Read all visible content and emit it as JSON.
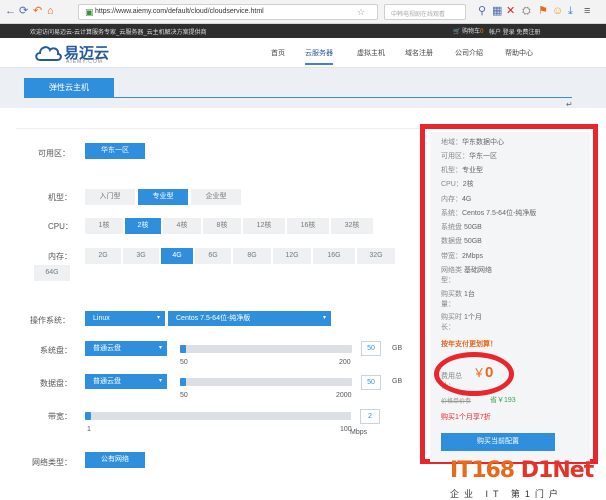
{
  "browser": {
    "url": "https://www.aiemy.com/default/cloud/cloudservice.html",
    "search_placeholder": "中韩电视剧在线观看",
    "icons": [
      "back-icon",
      "refresh-icon",
      "undo-icon",
      "home-icon",
      "lock-icon",
      "star-icon",
      "search-icon",
      "extension-icon",
      "user-icon",
      "download-icon"
    ]
  },
  "site_top": {
    "welcome": "欢迎访问易迈云-云计算服务专家_云服务器_云主机解决方案提供商",
    "cart": "购物车",
    "cart_count": "0",
    "links": "帐户  登录  免费注册"
  },
  "header": {
    "logo_cn": "易迈云",
    "logo_en": "AIEMY.COM",
    "nav": [
      {
        "label": "首页"
      },
      {
        "label": "云服务器",
        "active": true
      },
      {
        "label": "虚拟主机"
      },
      {
        "label": "域名注册"
      },
      {
        "label": "公司介绍"
      },
      {
        "label": "帮助中心"
      }
    ]
  },
  "tab": {
    "label": "弹性云主机"
  },
  "return_mark": "↵",
  "form": {
    "region": {
      "label": "可用区：",
      "value": "华东一区"
    },
    "model": {
      "label": "机型：",
      "options": [
        "入门型",
        "专业型",
        "企业型"
      ],
      "selected": 1
    },
    "cpu": {
      "label": "CPU：",
      "options": [
        "1核",
        "2核",
        "4核",
        "8核",
        "12核",
        "16核",
        "32核"
      ],
      "selected": 1
    },
    "memory": {
      "label": "内存：",
      "options": [
        "2G",
        "3G",
        "4G",
        "6G",
        "8G",
        "12G",
        "16G",
        "32G",
        "64G"
      ],
      "selected": 2
    },
    "os": {
      "label": "操作系统：",
      "family": "Linux",
      "image": "Centos 7.5-64位-纯净版"
    },
    "system_disk": {
      "label": "系统盘：",
      "type": "普通云盘",
      "min": "50",
      "max": "200",
      "value": "50",
      "unit": "GB",
      "fill": 0.02
    },
    "data_disk": {
      "label": "数据盘：",
      "type": "普通云盘",
      "min": "50",
      "max": "2000",
      "value": "50",
      "unit": "GB",
      "fill": 0.02
    },
    "bandwidth": {
      "label": "带宽：",
      "min": "1",
      "max": "100",
      "value": "2",
      "unit": "Mbps",
      "fill": 0.01
    },
    "network": {
      "label": "网络类型：",
      "value": "公有网络"
    }
  },
  "summary": {
    "rows": [
      {
        "k": "地域：",
        "v": "华东数据中心"
      },
      {
        "k": "可用区：",
        "v": "华东一区"
      },
      {
        "k": "机型：",
        "v": "专业型"
      },
      {
        "k": "CPU：",
        "v": "2核"
      },
      {
        "k": "内存：",
        "v": "4G"
      },
      {
        "k": "系统：",
        "v": "Centos 7.5-64位-纯净版"
      },
      {
        "k": "系统盘",
        "v": "50GB"
      },
      {
        "k": "数据盘",
        "v": "50GB"
      },
      {
        "k": "带宽：",
        "v": "2Mbps"
      },
      {
        "k": "网络类",
        "v": "基础网络",
        "k2": "型："
      },
      {
        "k": "购买数",
        "v": "1台",
        "k2": "量："
      },
      {
        "k": "购买时",
        "v": "1个月",
        "k2": "长："
      }
    ],
    "promo": "按年支付更划算！",
    "total_label_1": "费用总",
    "total_label_2": "计：",
    "currency": "￥",
    "total": "0",
    "ref_label": "价格单价参",
    "save_text": "省￥193",
    "deal": "购买1个月享7折",
    "buy_button": "购买当前配置"
  },
  "watermark": {
    "logo": "IT168",
    "logo_n": "D1Net",
    "sub": "企业 IT 第1门户"
  },
  "colors": {
    "accent": "#2f8fdd",
    "highlight_red": "#e8262b",
    "price_orange": "#e8681c"
  }
}
